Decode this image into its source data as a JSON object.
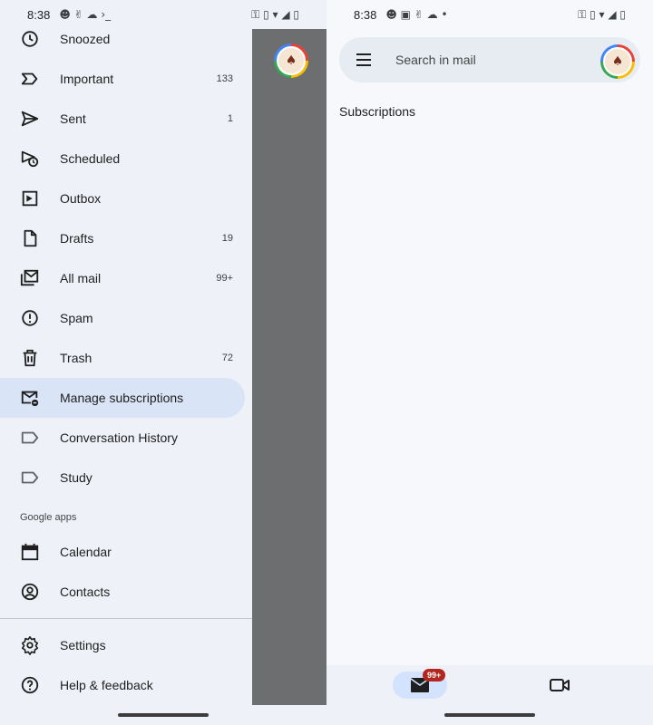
{
  "status_bar": {
    "left": {
      "time": "8:38",
      "glyphs": "☻ ✌ ☁ ›_"
    },
    "right": {
      "time": "8:38",
      "glyphs": "☻ ▣ ✌ ☁ •"
    },
    "system_icons": "⚿ ▯ ▾ ◢ ▯"
  },
  "drawer": {
    "items": [
      {
        "label": "Snoozed",
        "count": "",
        "icon": "clock-icon"
      },
      {
        "label": "Important",
        "count": "133",
        "icon": "important-icon"
      },
      {
        "label": "Sent",
        "count": "1",
        "icon": "send-icon"
      },
      {
        "label": "Scheduled",
        "count": "",
        "icon": "schedule-send-icon"
      },
      {
        "label": "Outbox",
        "count": "",
        "icon": "outbox-icon"
      },
      {
        "label": "Drafts",
        "count": "19",
        "icon": "draft-icon"
      },
      {
        "label": "All mail",
        "count": "99+",
        "icon": "all-mail-icon"
      },
      {
        "label": "Spam",
        "count": "",
        "icon": "spam-icon"
      },
      {
        "label": "Trash",
        "count": "72",
        "icon": "trash-icon"
      },
      {
        "label": "Manage subscriptions",
        "count": "",
        "icon": "manage-subscriptions-icon",
        "selected": true
      },
      {
        "label": "Conversation History",
        "count": "",
        "icon": "label-icon"
      },
      {
        "label": "Study",
        "count": "",
        "icon": "label-icon"
      }
    ],
    "google_apps_header": "Google apps",
    "apps": [
      {
        "label": "Calendar",
        "icon": "calendar-icon"
      },
      {
        "label": "Contacts",
        "icon": "contacts-icon"
      }
    ],
    "footer": [
      {
        "label": "Settings",
        "icon": "gear-icon"
      },
      {
        "label": "Help & feedback",
        "icon": "help-icon"
      }
    ]
  },
  "main": {
    "search_placeholder": "Search in mail",
    "section_title": "Subscriptions",
    "mail_badge": "99+"
  },
  "colors": {
    "selected_bg": "#d9e4f7",
    "badge": "#b3261e",
    "scrim": "#6d6e70"
  }
}
